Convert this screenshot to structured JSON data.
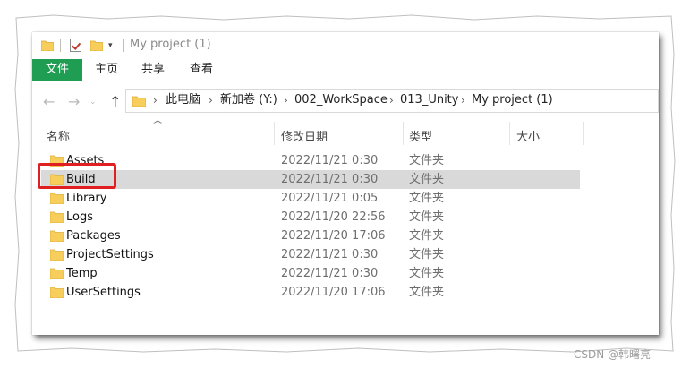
{
  "window": {
    "title": "My project (1)"
  },
  "ribbon": {
    "tabs": [
      "文件",
      "主页",
      "共享",
      "查看"
    ],
    "file_tab_color": "#1f9d52"
  },
  "nav": {
    "back_icon": "←",
    "forward_icon": "→",
    "recent_icon": "⌄",
    "up_icon": "↑"
  },
  "address": {
    "separator": "›",
    "crumbs": [
      "此电脑",
      "新加卷 (Y:)",
      "002_WorkSpace",
      "013_Unity",
      "My project (1)"
    ]
  },
  "columns": {
    "name": "名称",
    "date": "修改日期",
    "type": "类型",
    "size": "大小",
    "sort_indicator": "^"
  },
  "files": [
    {
      "name": "Assets",
      "date": "2022/11/21 0:30",
      "type": "文件夹"
    },
    {
      "name": "Build",
      "date": "2022/11/21 0:30",
      "type": "文件夹",
      "selected": true
    },
    {
      "name": "Library",
      "date": "2022/11/21 0:05",
      "type": "文件夹"
    },
    {
      "name": "Logs",
      "date": "2022/11/20 22:56",
      "type": "文件夹"
    },
    {
      "name": "Packages",
      "date": "2022/11/20 17:06",
      "type": "文件夹"
    },
    {
      "name": "ProjectSettings",
      "date": "2022/11/21 0:30",
      "type": "文件夹"
    },
    {
      "name": "Temp",
      "date": "2022/11/21 0:30",
      "type": "文件夹"
    },
    {
      "name": "UserSettings",
      "date": "2022/11/20 17:06",
      "type": "文件夹"
    }
  ],
  "colors": {
    "folder": "#f7ce5b",
    "highlight_box": "#e02020",
    "selected_row": "#d9d9d9"
  },
  "watermark": "CSDN @韩曙亮"
}
